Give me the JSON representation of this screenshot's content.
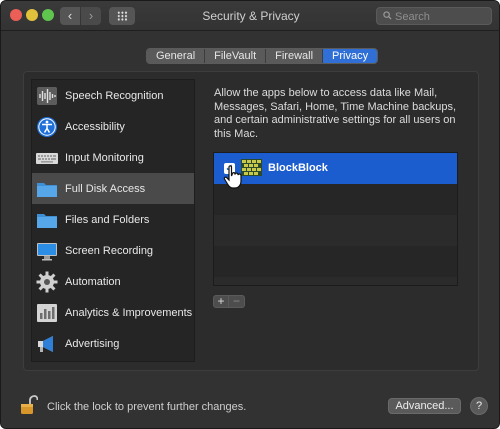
{
  "window": {
    "title": "Security & Privacy",
    "search": {
      "placeholder": "Search",
      "value": ""
    },
    "nav": {
      "back_glyph": "‹",
      "forward_glyph": "›"
    }
  },
  "tabs": [
    {
      "label": "General",
      "active": false
    },
    {
      "label": "FileVault",
      "active": false
    },
    {
      "label": "Firewall",
      "active": false
    },
    {
      "label": "Privacy",
      "active": true
    }
  ],
  "sidebar": {
    "items": [
      {
        "label": "Speech Recognition",
        "icon": "speech-waveform-icon"
      },
      {
        "label": "Accessibility",
        "icon": "accessibility-icon"
      },
      {
        "label": "Input Monitoring",
        "icon": "keyboard-icon"
      },
      {
        "label": "Full Disk Access",
        "icon": "folder-icon",
        "selected": true
      },
      {
        "label": "Files and Folders",
        "icon": "folder-icon"
      },
      {
        "label": "Screen Recording",
        "icon": "display-icon"
      },
      {
        "label": "Automation",
        "icon": "gear-icon"
      },
      {
        "label": "Analytics & Improvements",
        "icon": "analytics-chart-icon"
      },
      {
        "label": "Advertising",
        "icon": "megaphone-icon"
      }
    ]
  },
  "main": {
    "description": "Allow the apps below to access data like Mail, Messages, Safari, Home, Time Machine backups, and certain administrative settings for all users on this Mac.",
    "apps": [
      {
        "name": "BlockBlock",
        "checked": true,
        "icon": "blockblock-app-icon"
      }
    ],
    "add_label": "+",
    "remove_label": "−"
  },
  "footer": {
    "lock_message": "Click the lock to prevent further changes.",
    "advanced_label": "Advanced...",
    "help_label": "?"
  },
  "colors": {
    "accent": "#2f6fd6",
    "selection": "#1b5ccf",
    "window_bg": "#323232"
  }
}
